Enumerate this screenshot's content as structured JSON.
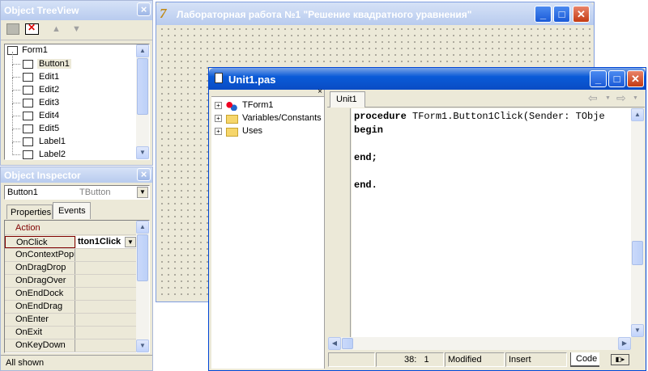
{
  "treeview": {
    "title": "Object TreeView",
    "close": "×",
    "root": "Form1",
    "items": [
      "Button1",
      "Edit1",
      "Edit2",
      "Edit3",
      "Edit4",
      "Edit5",
      "Label1",
      "Label2"
    ],
    "selected": "Button1"
  },
  "inspector": {
    "title": "Object Inspector",
    "close": "×",
    "object_name": "Button1",
    "object_type": "TButton",
    "tabs": [
      "Properties",
      "Events"
    ],
    "active_tab": "Events",
    "category": "Action",
    "rows": [
      {
        "name": "OnClick",
        "value": "tton1Click"
      },
      {
        "name": "OnContextPopup",
        "value": ""
      },
      {
        "name": "OnDragDrop",
        "value": ""
      },
      {
        "name": "OnDragOver",
        "value": ""
      },
      {
        "name": "OnEndDock",
        "value": ""
      },
      {
        "name": "OnEndDrag",
        "value": ""
      },
      {
        "name": "OnEnter",
        "value": ""
      },
      {
        "name": "OnExit",
        "value": ""
      },
      {
        "name": "OnKeyDown",
        "value": ""
      }
    ],
    "status": "All shown"
  },
  "form": {
    "title": "Лабораторная работа №1 \"Решение квадратного уравнения\""
  },
  "editor": {
    "title": "Unit1.pas",
    "tab": "Unit1",
    "explorer": [
      "TForm1",
      "Variables/Constants",
      "Uses"
    ],
    "code": [
      {
        "kw": "procedure",
        "rest": " TForm1.Button1Click(Sender: TObje"
      },
      {
        "kw": "begin",
        "rest": ""
      },
      {
        "kw": "",
        "rest": ""
      },
      {
        "kw": "end;",
        "rest": ""
      },
      {
        "kw": "",
        "rest": ""
      },
      {
        "kw": "end.",
        "rest": ""
      }
    ],
    "status": {
      "position": "38:   1",
      "modified": "Modified",
      "mode": "Insert",
      "view_tab": "Code"
    }
  }
}
